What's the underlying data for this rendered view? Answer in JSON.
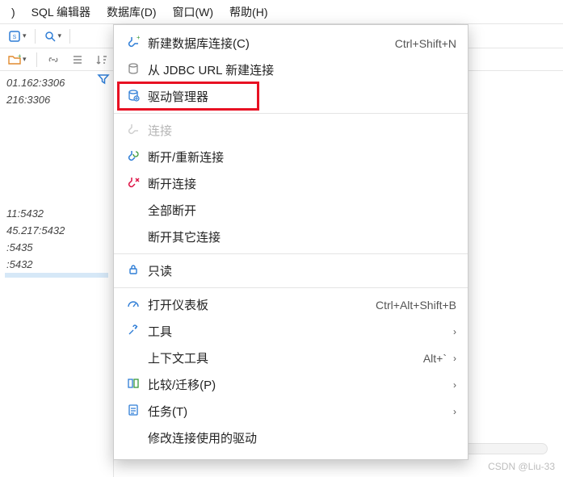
{
  "menubar": {
    "items": [
      {
        "label": ")"
      },
      {
        "label": "SQL 编辑器"
      },
      {
        "label": "数据库(D)"
      },
      {
        "label": "窗口(W)"
      },
      {
        "label": "帮助(H)"
      }
    ]
  },
  "sidebar": {
    "lines": [
      "01.162:3306",
      "216:3306",
      "",
      "",
      "",
      "",
      "11:5432",
      "45.217:5432",
      ":5435",
      ":5432"
    ],
    "selected_blank": ""
  },
  "dropdown": {
    "items": [
      {
        "icon": "plug-plus-icon",
        "label": "新建数据库连接(C)",
        "shortcut": "Ctrl+Shift+N",
        "interactable": true
      },
      {
        "icon": "database-icon",
        "label": "从 JDBC URL 新建连接",
        "shortcut": "",
        "interactable": true
      },
      {
        "icon": "driver-icon",
        "label": "驱动管理器",
        "shortcut": "",
        "interactable": true,
        "highlighted": true
      },
      {
        "sep": true
      },
      {
        "icon": "plug-icon",
        "label": "连接",
        "shortcut": "",
        "interactable": false,
        "disabled": true
      },
      {
        "icon": "plug-refresh-icon",
        "label": "断开/重新连接",
        "shortcut": "",
        "interactable": true
      },
      {
        "icon": "plug-x-icon",
        "label": "断开连接",
        "shortcut": "",
        "interactable": true
      },
      {
        "icon": "",
        "label": "全部断开",
        "shortcut": "",
        "interactable": true
      },
      {
        "icon": "",
        "label": "断开其它连接",
        "shortcut": "",
        "interactable": true
      },
      {
        "sep": true
      },
      {
        "icon": "lock-icon",
        "label": "只读",
        "shortcut": "",
        "interactable": true
      },
      {
        "sep": true
      },
      {
        "icon": "gauge-icon",
        "label": "打开仪表板",
        "shortcut": "Ctrl+Alt+Shift+B",
        "interactable": true
      },
      {
        "icon": "tools-icon",
        "label": "工具",
        "shortcut": "",
        "submenu": true,
        "interactable": true
      },
      {
        "icon": "",
        "label": "上下文工具",
        "shortcut": "Alt+`",
        "submenu": true,
        "interactable": true
      },
      {
        "icon": "compare-icon",
        "label": "比较/迁移(P)",
        "shortcut": "",
        "submenu": true,
        "interactable": true
      },
      {
        "icon": "tasks-icon",
        "label": "任务(T)",
        "shortcut": "",
        "submenu": true,
        "interactable": true
      },
      {
        "icon": "",
        "label": "修改连接使用的驱动",
        "shortcut": "",
        "interactable": true
      }
    ]
  },
  "watermark": "CSDN @Liu-33"
}
